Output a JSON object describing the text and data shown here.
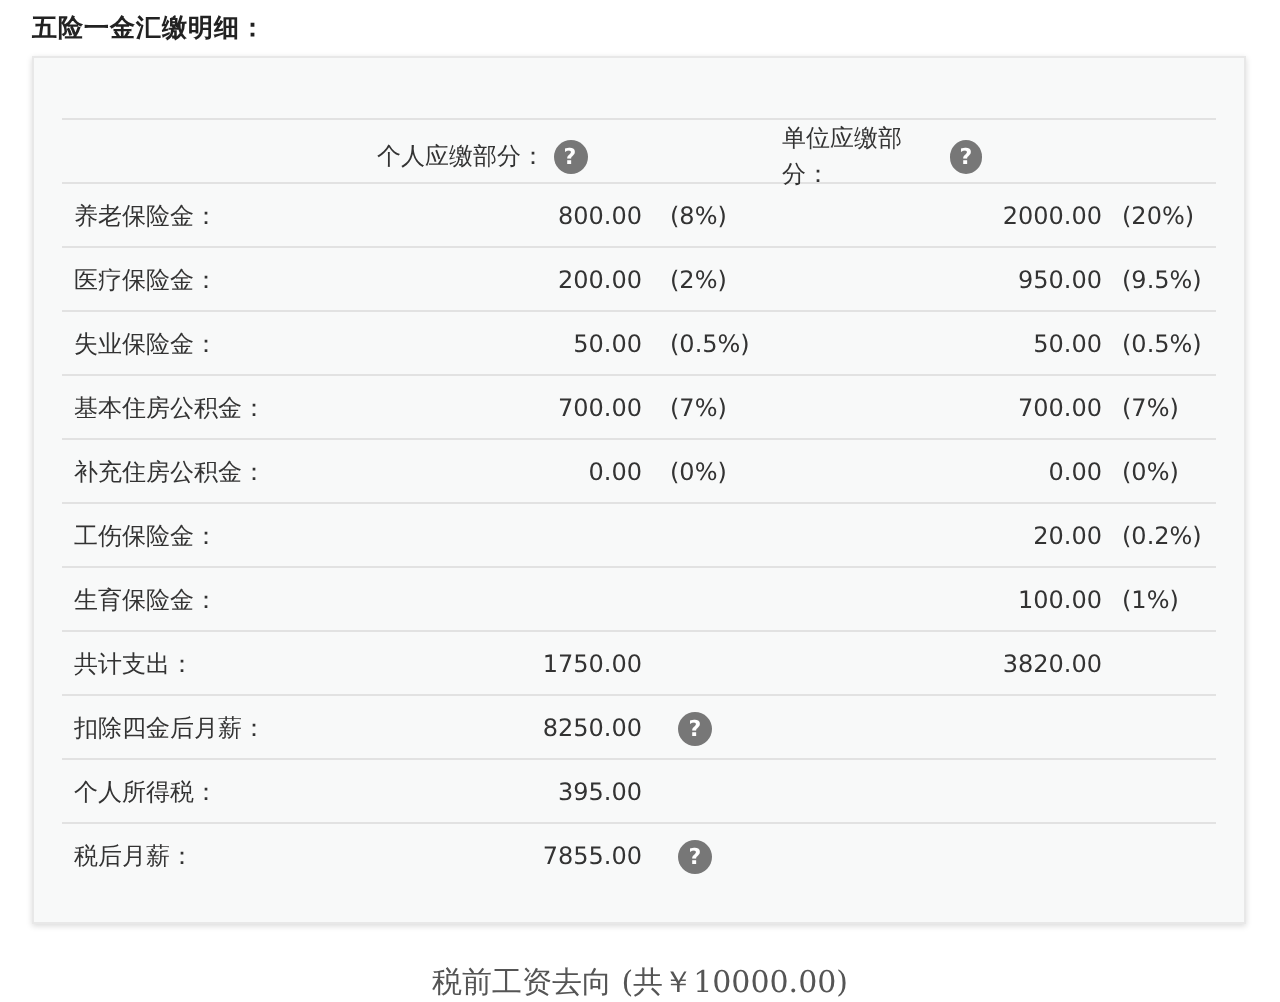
{
  "title": "五险一金汇缴明细：",
  "header": {
    "personal": {
      "label": "个人应缴部分：",
      "help": "?"
    },
    "company": {
      "label": "单位应缴部分：",
      "help": "?"
    }
  },
  "rows": [
    {
      "label": "养老保险金：",
      "personal_amount": "800.00",
      "personal_rate": "(8%)",
      "company_amount": "2000.00",
      "company_rate": "(20%)"
    },
    {
      "label": "医疗保险金：",
      "personal_amount": "200.00",
      "personal_rate": "(2%)",
      "company_amount": "950.00",
      "company_rate": "(9.5%)"
    },
    {
      "label": "失业保险金：",
      "personal_amount": "50.00",
      "personal_rate": "(0.5%)",
      "company_amount": "50.00",
      "company_rate": "(0.5%)"
    },
    {
      "label": "基本住房公积金：",
      "personal_amount": "700.00",
      "personal_rate": "(7%)",
      "company_amount": "700.00",
      "company_rate": "(7%)"
    },
    {
      "label": "补充住房公积金：",
      "personal_amount": "0.00",
      "personal_rate": "(0%)",
      "company_amount": "0.00",
      "company_rate": "(0%)"
    },
    {
      "label": "工伤保险金：",
      "company_amount": "20.00",
      "company_rate": "(0.2%)"
    },
    {
      "label": "生育保险金：",
      "company_amount": "100.00",
      "company_rate": "(1%)"
    },
    {
      "label": "共计支出：",
      "personal_amount": "1750.00",
      "company_amount": "3820.00"
    },
    {
      "label": "扣除四金后月薪：",
      "personal_amount": "8250.00",
      "help": "?"
    },
    {
      "label": "个人所得税：",
      "personal_amount": "395.00"
    },
    {
      "label": "税后月薪：",
      "personal_amount": "7855.00",
      "help": "?"
    }
  ],
  "footer": "税前工资去向 (共￥10000.00)"
}
